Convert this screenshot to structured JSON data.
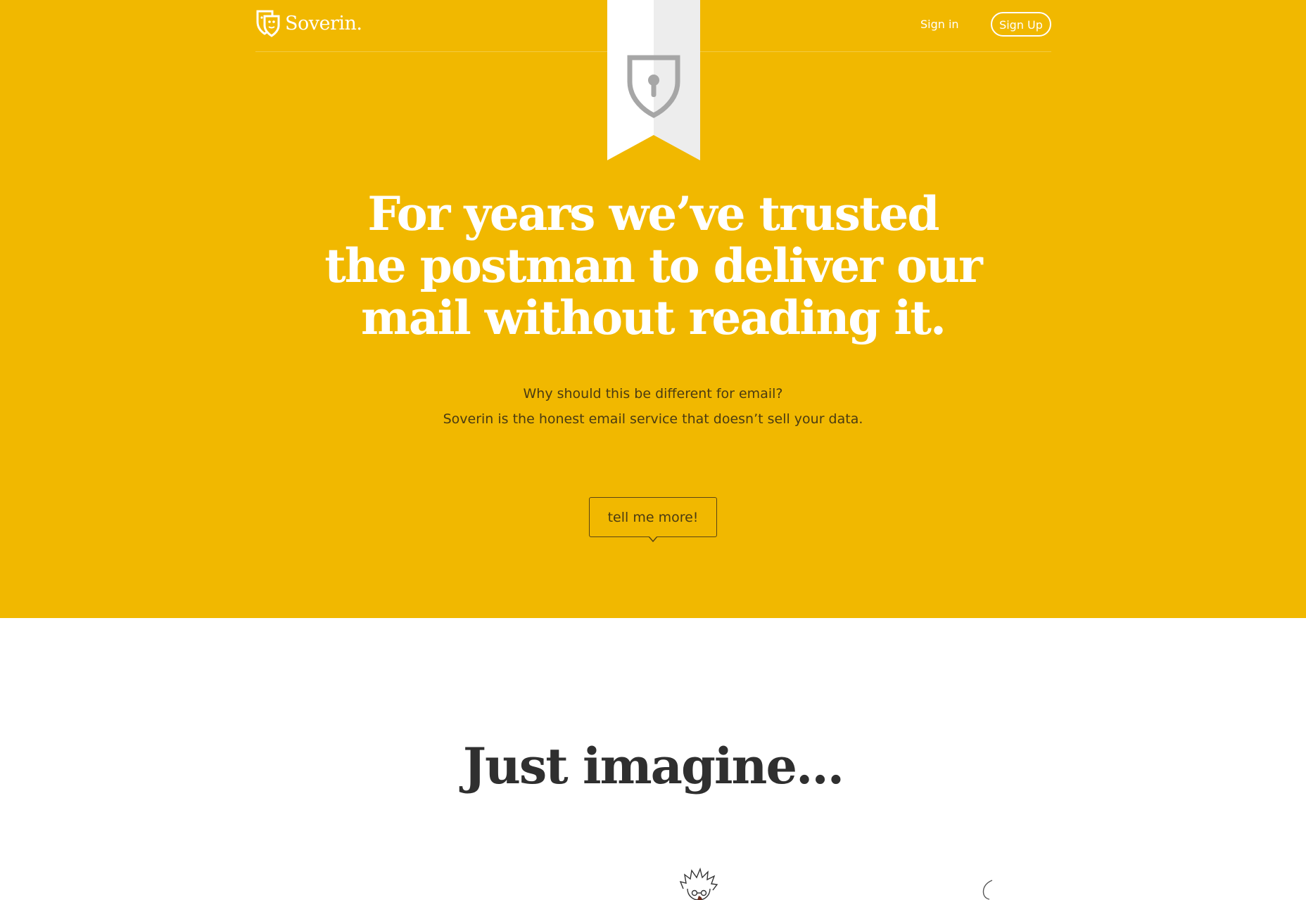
{
  "brand": {
    "name": "Soverin.",
    "logo_icon": "shield-masks-icon"
  },
  "nav": {
    "signin_label": "Sign in",
    "signup_label": "Sign Up"
  },
  "hero": {
    "ribbon_icon": "shield-keyhole-icon",
    "headline_lines": [
      "For years we’ve trusted",
      "the postman to deliver our",
      "mail without reading it."
    ],
    "sub_lines": [
      "Why should this be different for email?",
      "Soverin is the honest email service that doesn’t sell your data."
    ],
    "cta_label": "tell me more!"
  },
  "section": {
    "title": "Just imagine..."
  },
  "colors": {
    "hero_bg": "#F1B800",
    "headline": "#FFFFFF",
    "body_text": "#4A3B12",
    "section_title": "#2F2F2F",
    "ribbon": "#FFFFFF",
    "ribbon_shadow": "#EDEDED",
    "ribbon_icon": "#A6A6A6"
  }
}
